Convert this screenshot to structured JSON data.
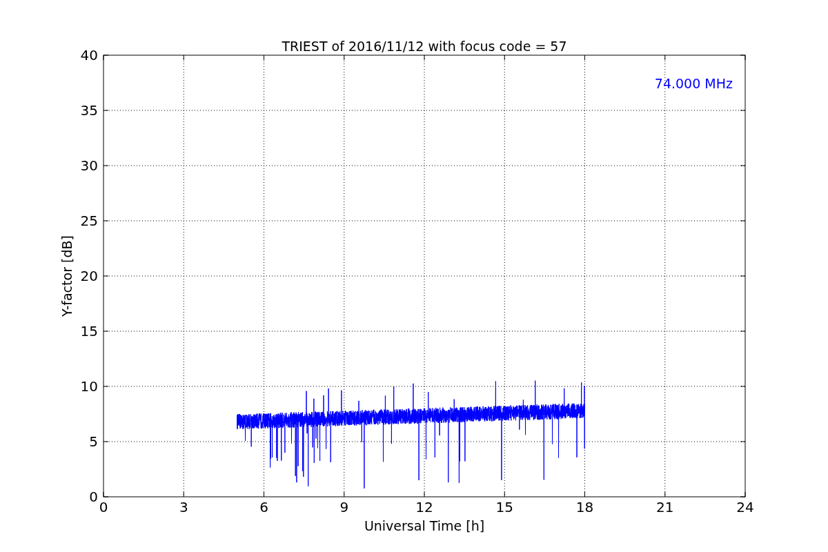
{
  "figure": {
    "title": "TRIEST of 2016/11/12 with focus code = 57",
    "xlabel": "Universal Time [h]",
    "ylabel": "Y-factor [dB]",
    "annotation": "74.000 MHz",
    "xticks": [
      "0",
      "3",
      "6",
      "9",
      "12",
      "15",
      "18",
      "21",
      "24"
    ],
    "yticks": [
      "40",
      "35",
      "30",
      "25",
      "20",
      "15",
      "10",
      "5",
      "0"
    ]
  }
}
